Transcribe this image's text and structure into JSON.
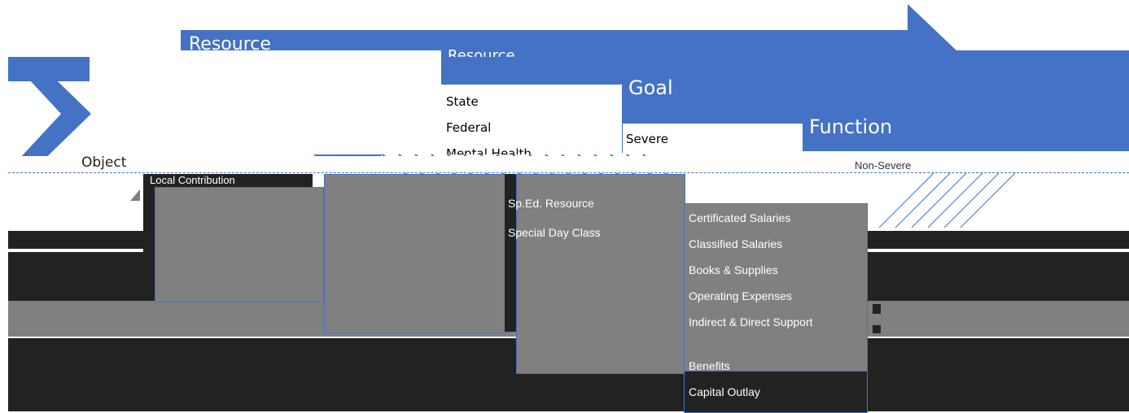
{
  "headers": {
    "resource": "Resource",
    "goal": "Goal",
    "function": "Function",
    "object": "Object"
  },
  "resource_items": [
    "State",
    "Federal",
    "Mental Health"
  ],
  "goal_items": [
    "Severe",
    "Non-Severe"
  ],
  "object_items": [
    "Local Contribution",
    "Sp.Ed. Resource",
    "Special Day Class"
  ],
  "function_items": [
    "Certificated Salaries",
    "Classified Salaries",
    "Books & Supplies",
    "Operating Expenses",
    "Indirect & Direct Support",
    "Benefits",
    "Capital Outlay"
  ],
  "colors": {
    "accent": "#4472c4",
    "dark": "#222222",
    "grey": "#808080"
  }
}
